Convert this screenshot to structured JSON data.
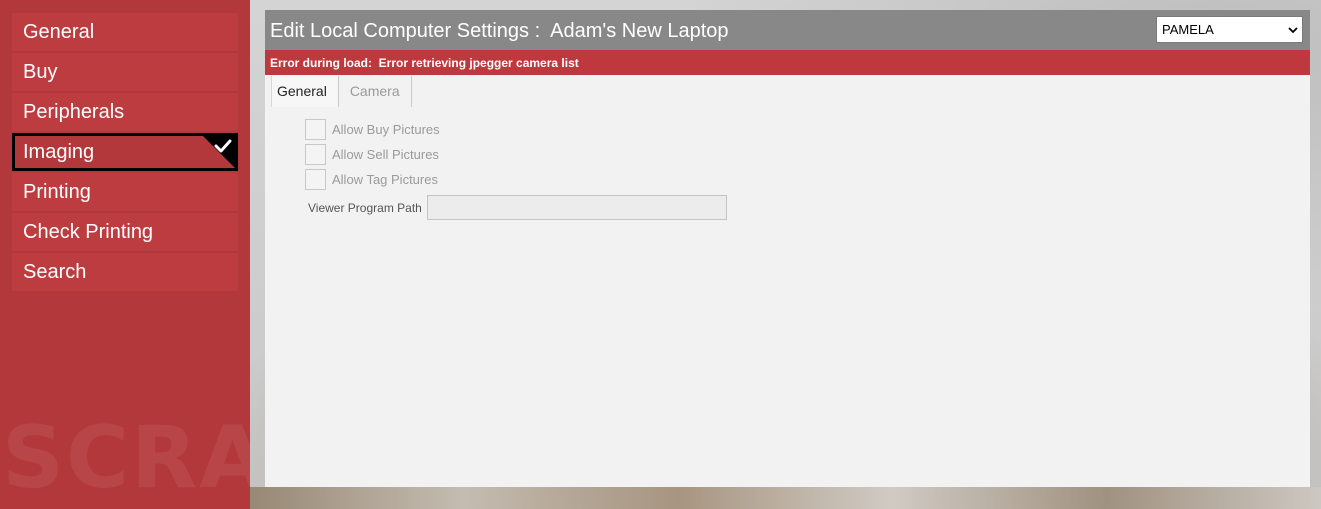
{
  "sidebar": {
    "watermark": "SCRAP",
    "items": [
      {
        "label": "General"
      },
      {
        "label": "Buy"
      },
      {
        "label": "Peripherals"
      },
      {
        "label": "Imaging"
      },
      {
        "label": "Printing"
      },
      {
        "label": "Check Printing"
      },
      {
        "label": "Search"
      }
    ],
    "active_item": "Imaging"
  },
  "header": {
    "title": "Edit Local Computer Settings :  Adam's New Laptop",
    "user_select": {
      "selected": "PAMELA"
    }
  },
  "error": {
    "text": "Error during load:  Error retrieving jpegger camera list"
  },
  "tabs": [
    {
      "label": "General",
      "active": true
    },
    {
      "label": "Camera",
      "active": false
    }
  ],
  "form": {
    "checkboxes": [
      {
        "label": "Allow Buy Pictures",
        "checked": false
      },
      {
        "label": "Allow Sell Pictures",
        "checked": false
      },
      {
        "label": "Allow Tag Pictures",
        "checked": false
      }
    ],
    "viewer_path": {
      "label": "Viewer Program Path",
      "value": ""
    }
  },
  "colors": {
    "sidebar_bg": "#b3383b",
    "nav_item_bg": "#bd3c40",
    "header_bg": "#888888",
    "error_bg": "#bf383d",
    "panel_bg": "#f2f2f2"
  }
}
